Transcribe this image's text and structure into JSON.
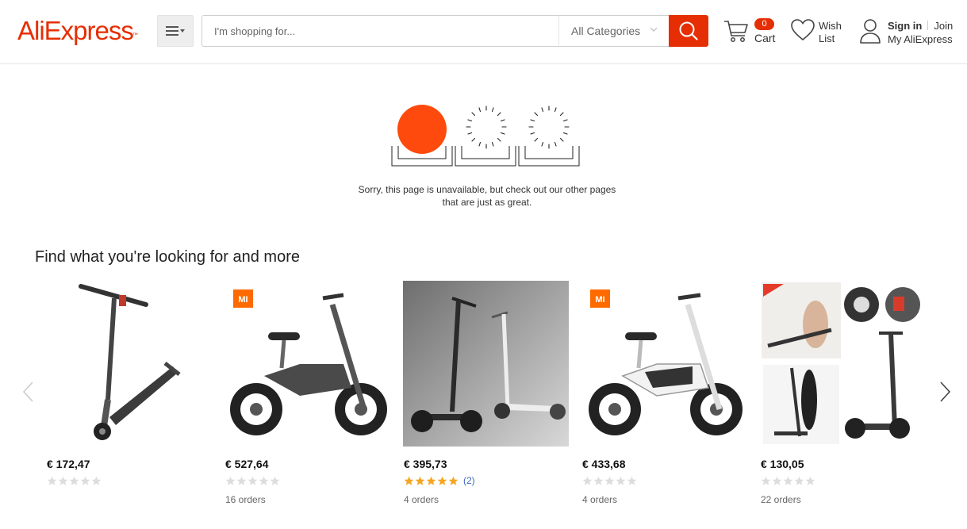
{
  "header": {
    "logo_text": "AliExpress",
    "logo_tm": "™",
    "search_placeholder": "I'm shopping for...",
    "category_label": "All Categories",
    "cart_count": "0",
    "cart_label": "Cart",
    "wish_label": "Wish List",
    "signin_label": "Sign in",
    "join_label": "Join",
    "account_label": "My AliExpress"
  },
  "error": {
    "line1": "Sorry, this page is unavailable, but check out our other pages",
    "line2": "that are just as great."
  },
  "section": {
    "title": "Find what you're looking for and more"
  },
  "products": [
    {
      "price": "€ 172,47",
      "stars": 0,
      "reviews": "",
      "orders": ""
    },
    {
      "price": "€ 527,64",
      "stars": 0,
      "reviews": "",
      "orders": "16 orders",
      "badge": "MI"
    },
    {
      "price": "€ 395,73",
      "stars": 5,
      "reviews": "(2)",
      "orders": "4 orders"
    },
    {
      "price": "€ 433,68",
      "stars": 0,
      "reviews": "",
      "orders": "4 orders",
      "badge": "MI"
    },
    {
      "price": "€ 130,05",
      "stars": 0,
      "reviews": "",
      "orders": "22 orders"
    }
  ],
  "colors": {
    "brand": "#e62e04",
    "star_filled": "#f5a623",
    "star_empty": "#dddddd",
    "review_link": "#3a66c4"
  },
  "icons": [
    "menu-icon",
    "chevron-down-icon",
    "search-icon",
    "cart-icon",
    "heart-icon",
    "user-icon",
    "chevron-left-icon",
    "chevron-right-icon",
    "star-icon"
  ]
}
